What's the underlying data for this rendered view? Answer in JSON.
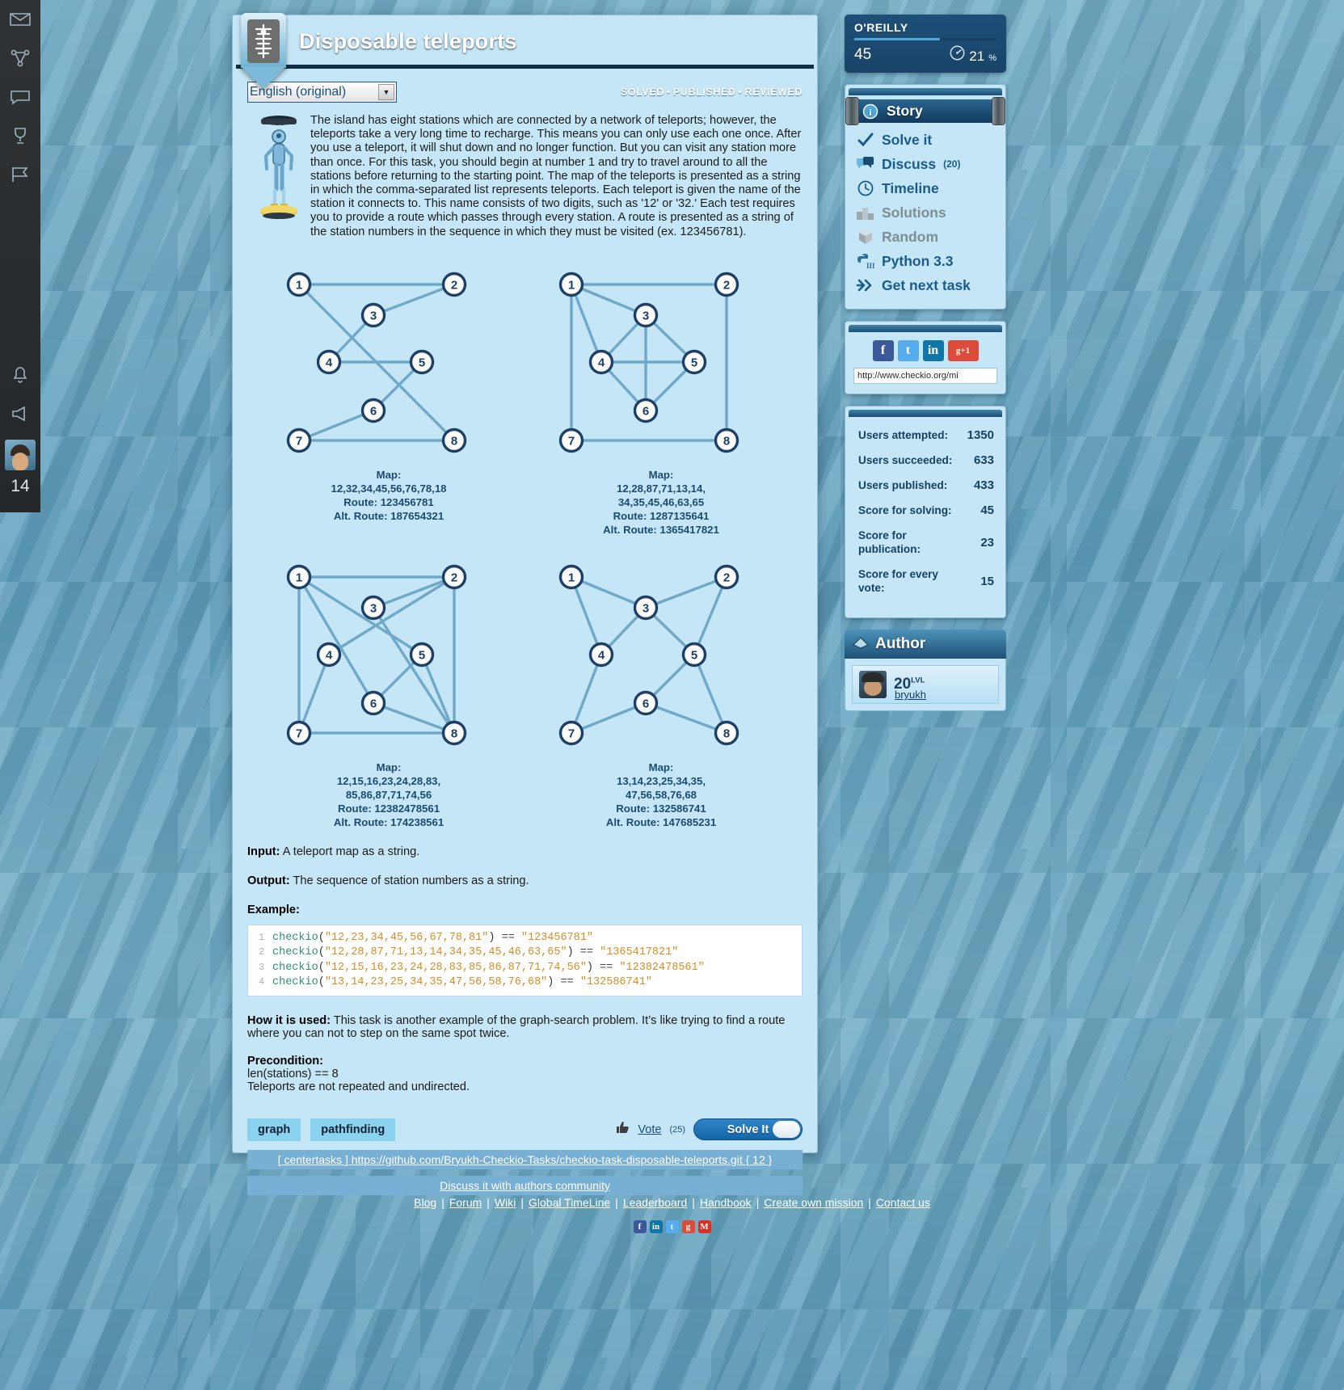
{
  "window": {
    "title": "Disposable teleports"
  },
  "rail": {
    "icons": [
      "envelope-icon",
      "network-icon",
      "speech-icon",
      "trophy-icon",
      "flag-icon",
      "bell-icon",
      "megaphone-icon"
    ],
    "level": "14"
  },
  "lang": {
    "value": "English (original)",
    "options": [
      "English (original)"
    ]
  },
  "status": {
    "solved": "SOLVED",
    "published": "PUBLISHED",
    "reviewed": "REVIEWED",
    "dot": "•"
  },
  "description": "The island has eight stations which are connected by a network of teleports; however, the teleports take a very long time to recharge. This means you can only use each one once. After you use a teleport, it will shut down and no longer function. But you can visit any station more than once. For this task, you should begin at number 1 and try to travel around to all the stations before returning to the starting point. The map of the teleports is presented as a string in which the comma-separated list represents teleports. Each teleport is given the name of the station it connects to. This name consists of two digits, such as '12' or '32.' Each test requires you to provide a route which passes through every station. A route is presented as a string of the station numbers in the sequence in which they must be visited (ex. 123456781).",
  "graphs": [
    {
      "map_label": "Map:",
      "map_lines": [
        "12,32,34,45,56,76,78,18"
      ],
      "route": "Route: 123456781",
      "alt_route": "Alt. Route: 187654321",
      "edges": [
        [
          1,
          2
        ],
        [
          3,
          2
        ],
        [
          3,
          4
        ],
        [
          4,
          5
        ],
        [
          5,
          6
        ],
        [
          7,
          6
        ],
        [
          7,
          8
        ],
        [
          1,
          8
        ]
      ]
    },
    {
      "map_label": "Map:",
      "map_lines": [
        "12,28,87,71,13,14,",
        "34,35,45,46,63,65"
      ],
      "route": "Route: 1287135641",
      "alt_route": "Alt. Route: 1365417821",
      "edges": [
        [
          1,
          2
        ],
        [
          2,
          8
        ],
        [
          8,
          7
        ],
        [
          7,
          1
        ],
        [
          1,
          3
        ],
        [
          1,
          4
        ],
        [
          3,
          4
        ],
        [
          3,
          5
        ],
        [
          4,
          5
        ],
        [
          4,
          6
        ],
        [
          6,
          3
        ],
        [
          6,
          5
        ]
      ]
    },
    {
      "map_label": "Map:",
      "map_lines": [
        "12,15,16,23,24,28,83,",
        "85,86,87,71,74,56"
      ],
      "route": "Route: 12382478561",
      "alt_route": "Alt. Route: 174238561",
      "edges": [
        [
          1,
          2
        ],
        [
          1,
          5
        ],
        [
          1,
          6
        ],
        [
          2,
          3
        ],
        [
          2,
          4
        ],
        [
          2,
          8
        ],
        [
          8,
          3
        ],
        [
          8,
          5
        ],
        [
          8,
          6
        ],
        [
          8,
          7
        ],
        [
          7,
          1
        ],
        [
          7,
          4
        ],
        [
          5,
          6
        ]
      ]
    },
    {
      "map_label": "Map:",
      "map_lines": [
        "13,14,23,25,34,35,",
        "47,56,58,76,68"
      ],
      "route": "Route: 132586741",
      "alt_route": "Alt. Route: 147685231",
      "edges": [
        [
          1,
          3
        ],
        [
          1,
          4
        ],
        [
          2,
          3
        ],
        [
          2,
          5
        ],
        [
          3,
          4
        ],
        [
          3,
          5
        ],
        [
          4,
          7
        ],
        [
          5,
          6
        ],
        [
          5,
          8
        ],
        [
          7,
          6
        ],
        [
          6,
          8
        ]
      ]
    }
  ],
  "io": {
    "input_label": "Input:",
    "input_text": "A teleport map as a string.",
    "output_label": "Output:",
    "output_text": "The sequence of station numbers as a string.",
    "example_label": "Example:"
  },
  "code": {
    "lines": [
      {
        "n": "1",
        "fn": "checkio",
        "arg": "\"12,23,34,45,56,67,78,81\"",
        "op": "==",
        "res": "\"123456781\""
      },
      {
        "n": "2",
        "fn": "checkio",
        "arg": "\"12,28,87,71,13,14,34,35,45,46,63,65\"",
        "op": "==",
        "res": "\"1365417821\""
      },
      {
        "n": "3",
        "fn": "checkio",
        "arg": "\"12,15,16,23,24,28,83,85,86,87,71,74,56\"",
        "op": "==",
        "res": "\"12382478561\""
      },
      {
        "n": "4",
        "fn": "checkio",
        "arg": "\"13,14,23,25,34,35,47,56,58,76,68\"",
        "op": "==",
        "res": "\"132586741\""
      }
    ]
  },
  "usage": {
    "label": "How it is used:",
    "text": "This task is another example of the graph-search problem. It’s like trying to find a route where you can not to step on the same spot twice."
  },
  "precondition": {
    "label": "Precondition:",
    "line1": "len(stations) == 8",
    "line2": "Teleports are not repeated and undirected."
  },
  "tags": [
    "graph",
    "pathfinding"
  ],
  "vote": {
    "label": "Vote",
    "count": "(25)",
    "icon": "thumbs-up-icon"
  },
  "solve_button": {
    "label": "Solve It"
  },
  "links": {
    "repo": "[ centertasks ] https://github.com/Bryukh-Checkio-Tasks/checkio-task-disposable-teleports.git { 12 }",
    "discuss": "Discuss it with authors community"
  },
  "oreilly": {
    "name": "O'REILLY",
    "level": "45",
    "percent": "21",
    "percent_symbol": "%",
    "gauge_icon": "speedometer-icon"
  },
  "nav": {
    "items": [
      {
        "label": "Story",
        "icon": "info-icon",
        "state": "selected",
        "count": ""
      },
      {
        "label": "Solve it",
        "icon": "check-icon",
        "state": "normal",
        "count": ""
      },
      {
        "label": "Discuss",
        "icon": "comments-icon",
        "state": "normal",
        "count": "(20)"
      },
      {
        "label": "Timeline",
        "icon": "clock-icon",
        "state": "normal",
        "count": ""
      },
      {
        "label": "Solutions",
        "icon": "podium-icon",
        "state": "disabled",
        "count": ""
      },
      {
        "label": "Random",
        "icon": "dice-icon",
        "state": "disabled",
        "count": ""
      },
      {
        "label": "Python 3.3",
        "icon": "python-icon",
        "state": "normal",
        "count": ""
      },
      {
        "label": "Get next task",
        "icon": "arrows-icon",
        "state": "normal",
        "count": ""
      }
    ]
  },
  "social": {
    "buttons": [
      {
        "name": "facebook-icon",
        "glyph": "f",
        "color": "#3b5998"
      },
      {
        "name": "twitter-icon",
        "glyph": "t",
        "color": "#55acee"
      },
      {
        "name": "linkedin-icon",
        "glyph": "in",
        "color": "#0e76a8"
      },
      {
        "name": "gplus-icon",
        "glyph": "g+1",
        "color": "#dd4b39"
      }
    ],
    "url": "http://www.checkio.org/mi"
  },
  "stats": {
    "rows": [
      {
        "key": "Users attempted:",
        "value": "1350"
      },
      {
        "key": "Users succeeded:",
        "value": "633"
      },
      {
        "key": "Users published:",
        "value": "433"
      },
      {
        "key": "Score for solving:",
        "value": "45"
      },
      {
        "key": "Score for publication:",
        "value": "23"
      },
      {
        "key": "Score for every vote:",
        "value": "15"
      }
    ]
  },
  "author": {
    "title": "Author",
    "level": "20",
    "level_suffix": "LVL",
    "name": "bryukh"
  },
  "footer": {
    "links": [
      "Blog",
      "Forum",
      "Wiki",
      "Global TimeLine",
      "Leaderboard",
      "Handbook",
      "Create own mission",
      "Contact us"
    ],
    "separator": "|",
    "social": [
      {
        "name": "facebook-icon",
        "glyph": "f",
        "color": "#3b5998"
      },
      {
        "name": "linkedin-icon",
        "glyph": "in",
        "color": "#0e76a8"
      },
      {
        "name": "twitter-icon",
        "glyph": "t",
        "color": "#55acee"
      },
      {
        "name": "gplus-icon",
        "glyph": "g",
        "color": "#dd4b39"
      },
      {
        "name": "mail-icon",
        "glyph": "M",
        "color": "#d93025"
      }
    ]
  },
  "colors": {
    "card_bg": "#c4e6f7",
    "accent_dark": "#1d4f77",
    "node_ring": "#1e3f66",
    "edge": "#6fa8c8",
    "tag_bg": "#8ad2ef"
  }
}
